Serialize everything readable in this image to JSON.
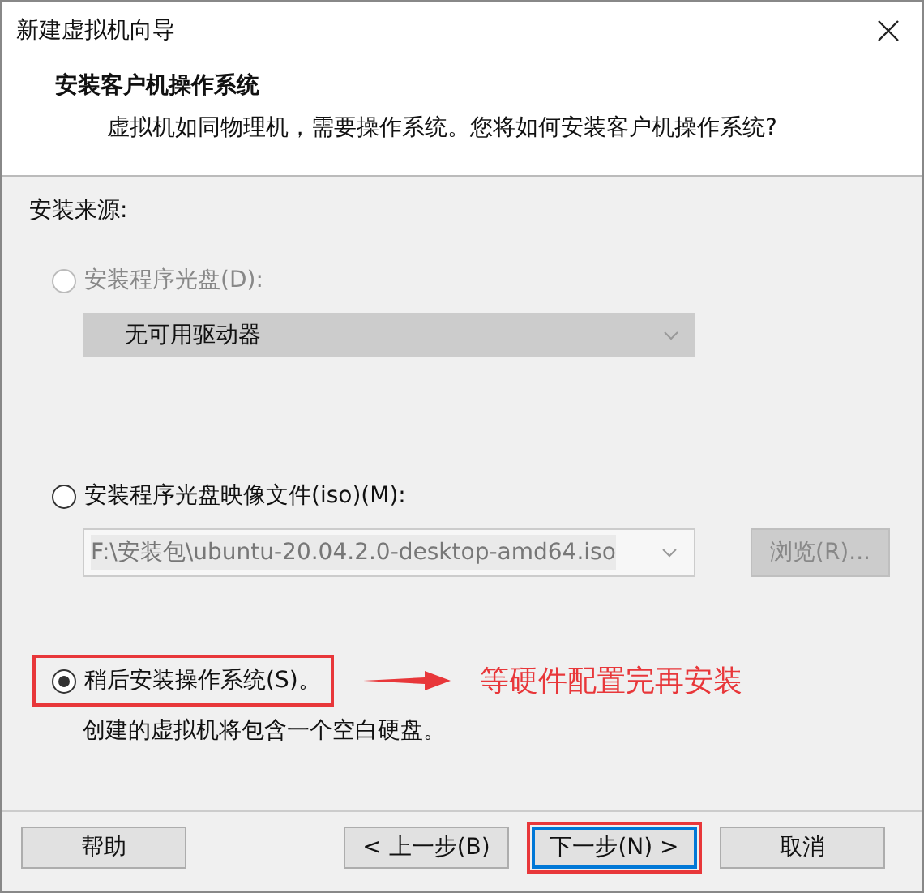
{
  "window": {
    "title": "新建虚拟机向导"
  },
  "header": {
    "title": "安装客户机操作系统",
    "subtitle": "虚拟机如同物理机，需要操作系统。您将如何安装客户机操作系统?"
  },
  "source_label": "安装来源:",
  "options": [
    {
      "kind": "disc",
      "label": "安装程序光盘(D):",
      "selected": false,
      "disabled": true,
      "highlighted": false,
      "field_value": "无可用驱动器",
      "field_disabled": true
    },
    {
      "kind": "iso",
      "label": "安装程序光盘映像文件(iso)(M):",
      "selected": false,
      "disabled": false,
      "highlighted": false,
      "field_value": "F:\\安装包\\ubuntu-20.04.2.0-desktop-amd64.iso",
      "field_disabled": true,
      "browse": {
        "label": "浏览(R)...",
        "disabled": true
      }
    },
    {
      "kind": "later",
      "label": "稍后安装操作系统(S)。",
      "selected": true,
      "disabled": false,
      "highlighted": true,
      "description": "创建的虚拟机将包含一个空白硬盘。",
      "annotation": "等硬件配置完再安装"
    }
  ],
  "buttons": [
    {
      "label": "帮助",
      "default": false,
      "highlighted": false
    },
    {
      "label": "< 上一步(B)",
      "default": false,
      "highlighted": false
    },
    {
      "label": "下一步(N) >",
      "default": true,
      "highlighted": true
    },
    {
      "label": "取消",
      "default": false,
      "highlighted": false
    }
  ]
}
